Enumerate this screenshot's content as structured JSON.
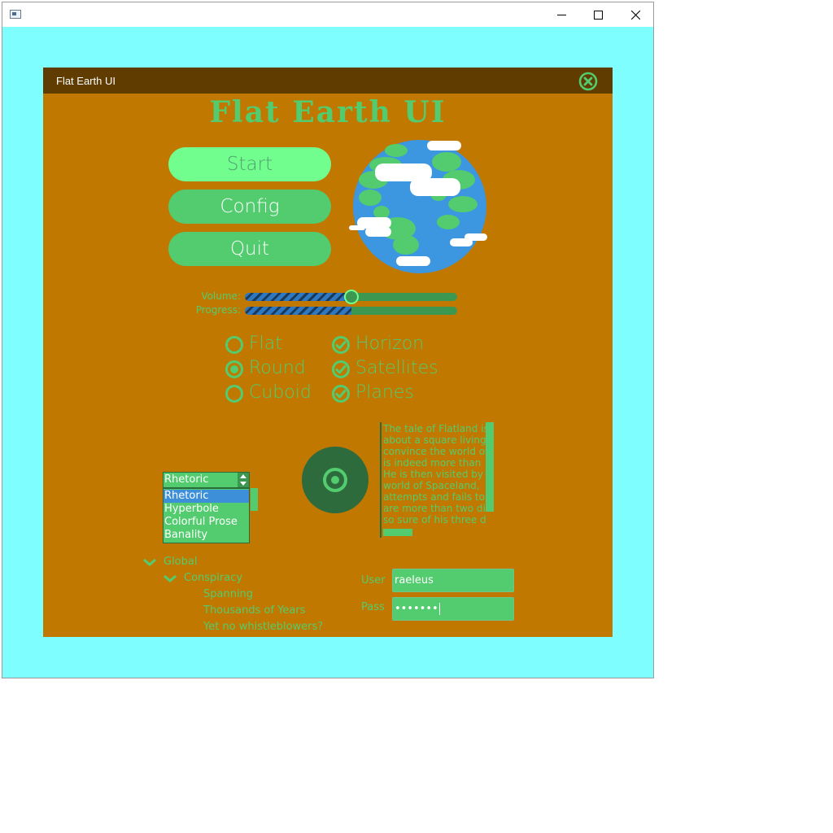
{
  "os_window": {
    "icon": "app-window-icon",
    "controls": [
      "minimize-icon",
      "maximize-icon",
      "close-icon"
    ]
  },
  "panel": {
    "title": "Flat Earth UI",
    "close_icon": "circle-x-icon"
  },
  "app_title": "Flat Earth UI",
  "menu": {
    "start": "Start",
    "config": "Config",
    "quit": "Quit"
  },
  "globe_icon": "earth-globe-icon",
  "sliders": {
    "volume_label": "Volume:",
    "volume_value": 0.5,
    "progress_label": "Progress:",
    "progress_value": 0.5
  },
  "radios": {
    "options": [
      "Flat",
      "Round",
      "Cuboid"
    ],
    "selected": "Round"
  },
  "checks": {
    "options": [
      "Horizon",
      "Satellites",
      "Planes"
    ],
    "checked": [
      "Horizon",
      "Satellites",
      "Planes"
    ]
  },
  "combo": {
    "value": "Rhetoric",
    "options": [
      "Rhetoric",
      "Hyperbole",
      "Colorful Prose",
      "Banality"
    ],
    "highlighted": "Rhetoric"
  },
  "knob_icon": "dial-knob-icon",
  "text_area": {
    "lines": [
      "The tale of Flatland is",
      "about a square living in",
      "convince the world of",
      "is indeed more than",
      "He is then visited by",
      "world of Spaceland,",
      "attempts and fails to",
      "are more than two di",
      "so sure of his three d",
      "........ ..... .. ...."
    ]
  },
  "tree": {
    "global": "Global",
    "conspiracy": "Conspiracy",
    "children": [
      "Spanning",
      "Thousands of Years",
      "Yet no whistleblowers?"
    ]
  },
  "login": {
    "user_label": "User",
    "user_value": "raeleus",
    "pass_label": "Pass",
    "pass_value": "•••••••"
  },
  "colors": {
    "window_bg": "#7efefe",
    "panel_bg": "#c17800",
    "header_bg": "#603c00",
    "accent_green": "#52cc6e",
    "bright_green": "#71fe8e",
    "dark_green": "#2e6b3c",
    "ocean_blue": "#3c96e0"
  }
}
